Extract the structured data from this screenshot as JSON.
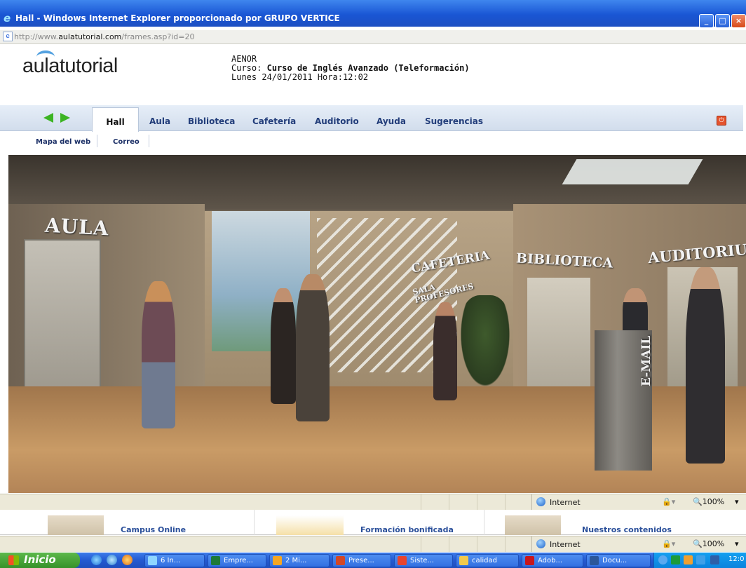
{
  "window": {
    "title": "Hall - Windows Internet Explorer proporcionado por GRUPO VERTICE"
  },
  "address_bar": {
    "url_prefix": "http://www.",
    "url_domain": "aulatutorial.com",
    "url_path": "/frames.asp?id=20"
  },
  "site": {
    "logo": "aulatutorial",
    "org": "AENOR",
    "course_label": "Curso:",
    "course_name": "Curso de Inglés Avanzado (Teleformación)",
    "date_line": "Lunes  24/01/2011  Hora:12:02"
  },
  "nav": {
    "tabs": [
      {
        "label": "Hall",
        "active": true
      },
      {
        "label": "Aula"
      },
      {
        "label": "Biblioteca"
      },
      {
        "label": "Cafetería"
      },
      {
        "label": "Auditorio"
      },
      {
        "label": "Ayuda"
      },
      {
        "label": "Sugerencias"
      }
    ],
    "sub_links": [
      "Mapa del web",
      "Correo"
    ]
  },
  "scene": {
    "signs": {
      "aula": "AULA",
      "cafeteria": "CAFETERIA",
      "sala_line1": "SALA",
      "sala_line2": "PROFESORES",
      "biblioteca": "BIBLIOTECA",
      "auditorio": "AUDITORIU",
      "email": "E-MAIL"
    }
  },
  "status_bar": {
    "zone": "Internet",
    "zoom": "100%"
  },
  "lower_cards": [
    "Campus Online",
    "Formación bonificada",
    "Nuestros contenidos"
  ],
  "taskbar": {
    "start_label": "Inicio",
    "tasks": [
      "6 In...",
      "Empre...",
      "2 Mi...",
      "Prese...",
      "Siste...",
      "calidad",
      "Adob...",
      "Docu..."
    ],
    "clock": "12:0"
  },
  "colors": {
    "title_bar": "#1a56d4",
    "nav_text": "#223d7a",
    "taskbar": "#245ad1",
    "start": "#36922a"
  }
}
